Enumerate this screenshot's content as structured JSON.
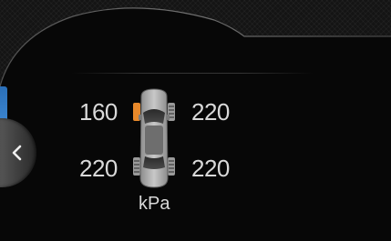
{
  "tpms": {
    "front_left": "160",
    "front_right": "220",
    "rear_left": "220",
    "rear_right": "220",
    "unit": "kPa"
  },
  "colors": {
    "warning_tire": "#e8892b",
    "normal_tire": "#9a9a9a",
    "text": "#d9d9d9",
    "nav_accent": "#3f8ad6"
  },
  "icons": {
    "back": "chevron-left-icon",
    "vehicle": "car-top-view-icon"
  }
}
